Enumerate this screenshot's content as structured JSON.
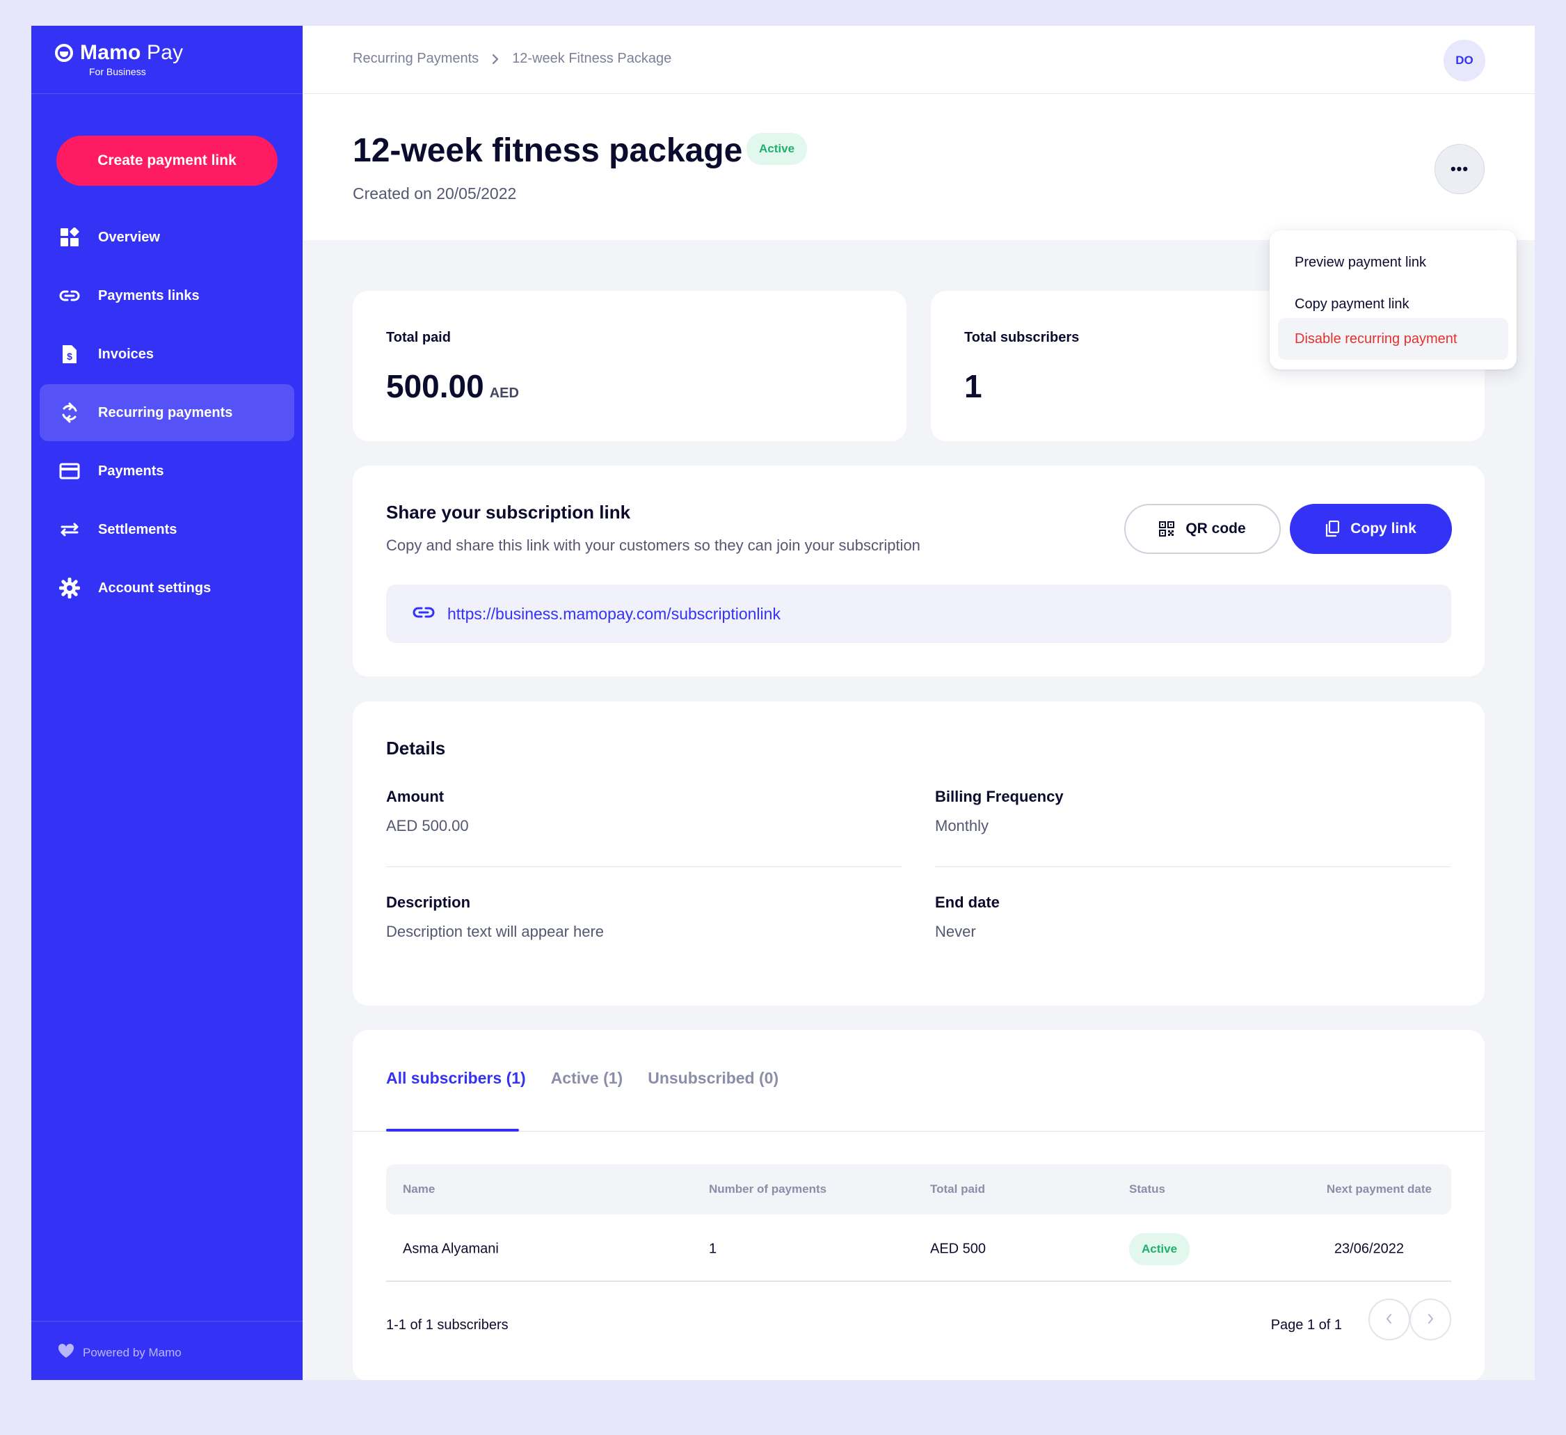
{
  "app": {
    "brand_name_bold": "Mamo",
    "brand_name_light": "Pay",
    "brand_sub": "For Business",
    "accent_color": "#3432f4",
    "cta_color": "#ff1b61"
  },
  "sidebar": {
    "create_button": "Create payment link",
    "items": [
      {
        "label": "Overview",
        "icon": "grid-icon"
      },
      {
        "label": "Payments links",
        "icon": "link-icon"
      },
      {
        "label": "Invoices",
        "icon": "invoice-icon"
      },
      {
        "label": "Recurring payments",
        "icon": "refresh-icon",
        "active": true
      },
      {
        "label": "Payments",
        "icon": "card-icon"
      },
      {
        "label": "Settlements",
        "icon": "transfer-icon"
      },
      {
        "label": "Account settings",
        "icon": "gear-icon"
      }
    ],
    "footer": "Powered by Mamo"
  },
  "header": {
    "breadcrumb": [
      "Recurring Payments",
      "12-week Fitness Package"
    ],
    "avatar_initials": "DO"
  },
  "page": {
    "title": "12-week fitness package",
    "status": "Active",
    "created": "Created on 20/05/2022",
    "more_label": "•••"
  },
  "menu": {
    "items": [
      "Preview payment link",
      "Copy payment link",
      "Disable recurring payment"
    ]
  },
  "stats": {
    "total_paid_label": "Total paid",
    "total_paid_value": "500.00",
    "total_paid_unit": "AED",
    "subscribers_label": "Total subscribers",
    "subscribers_value": "1"
  },
  "share": {
    "title": "Share your subscription link",
    "description": "Copy and share this link with your customers so they can join your subscription",
    "qr_button": "QR code",
    "copy_button": "Copy link",
    "url": "https://business.mamopay.com/subscriptionlink"
  },
  "details": {
    "title": "Details",
    "amount_label": "Amount",
    "amount_value": "AED 500.00",
    "frequency_label": "Billing Frequency",
    "frequency_value": "Monthly",
    "description_label": "Description",
    "description_value": "Description text will appear here",
    "end_label": "End date",
    "end_value": "Never"
  },
  "subscribers": {
    "tabs": [
      "All subscribers (1)",
      "Active (1)",
      "Unsubscribed (0)"
    ],
    "columns": [
      "Name",
      "Number of payments",
      "Total paid",
      "Status",
      "Next payment date"
    ],
    "rows": [
      {
        "name": "Asma Alyamani",
        "payments": "1",
        "total": "AED 500",
        "status": "Active",
        "next": "23/06/2022"
      }
    ],
    "count_text": "1-1 of 1 subscribers",
    "page_text": "Page 1 of 1"
  }
}
